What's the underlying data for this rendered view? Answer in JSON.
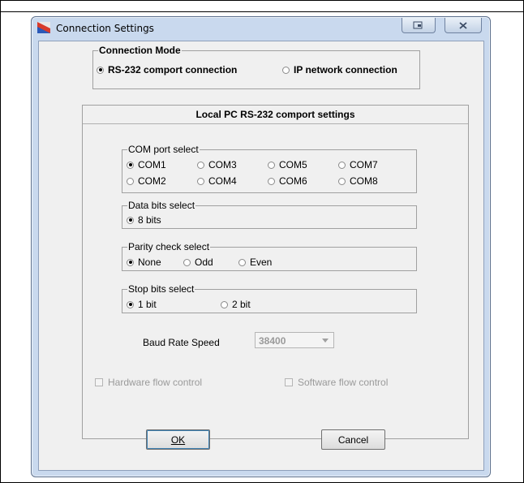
{
  "window": {
    "title": "Connection Settings"
  },
  "connection_mode": {
    "legend": "Connection Mode",
    "options": [
      {
        "label": "RS-232 comport connection",
        "selected": true
      },
      {
        "label": "IP network connection",
        "selected": false
      }
    ]
  },
  "panel": {
    "header": "Local PC RS-232 comport settings"
  },
  "com_port": {
    "legend": "COM port select",
    "options": [
      "COM1",
      "COM3",
      "COM5",
      "COM7",
      "COM2",
      "COM4",
      "COM6",
      "COM8"
    ],
    "selected": "COM1"
  },
  "data_bits": {
    "legend": "Data bits select",
    "options": [
      "8 bits"
    ],
    "selected": "8 bits"
  },
  "parity": {
    "legend": "Parity check select",
    "options": [
      "None",
      "Odd",
      "Even"
    ],
    "selected": "None"
  },
  "stop_bits": {
    "legend": "Stop bits select",
    "options": [
      "1 bit",
      "2 bit"
    ],
    "selected": "1 bit"
  },
  "baud": {
    "label": "Baud Rate Speed",
    "value": "38400"
  },
  "flow": {
    "hardware": "Hardware flow control",
    "software": "Software flow control"
  },
  "buttons": {
    "ok": "OK",
    "cancel": "Cancel"
  }
}
